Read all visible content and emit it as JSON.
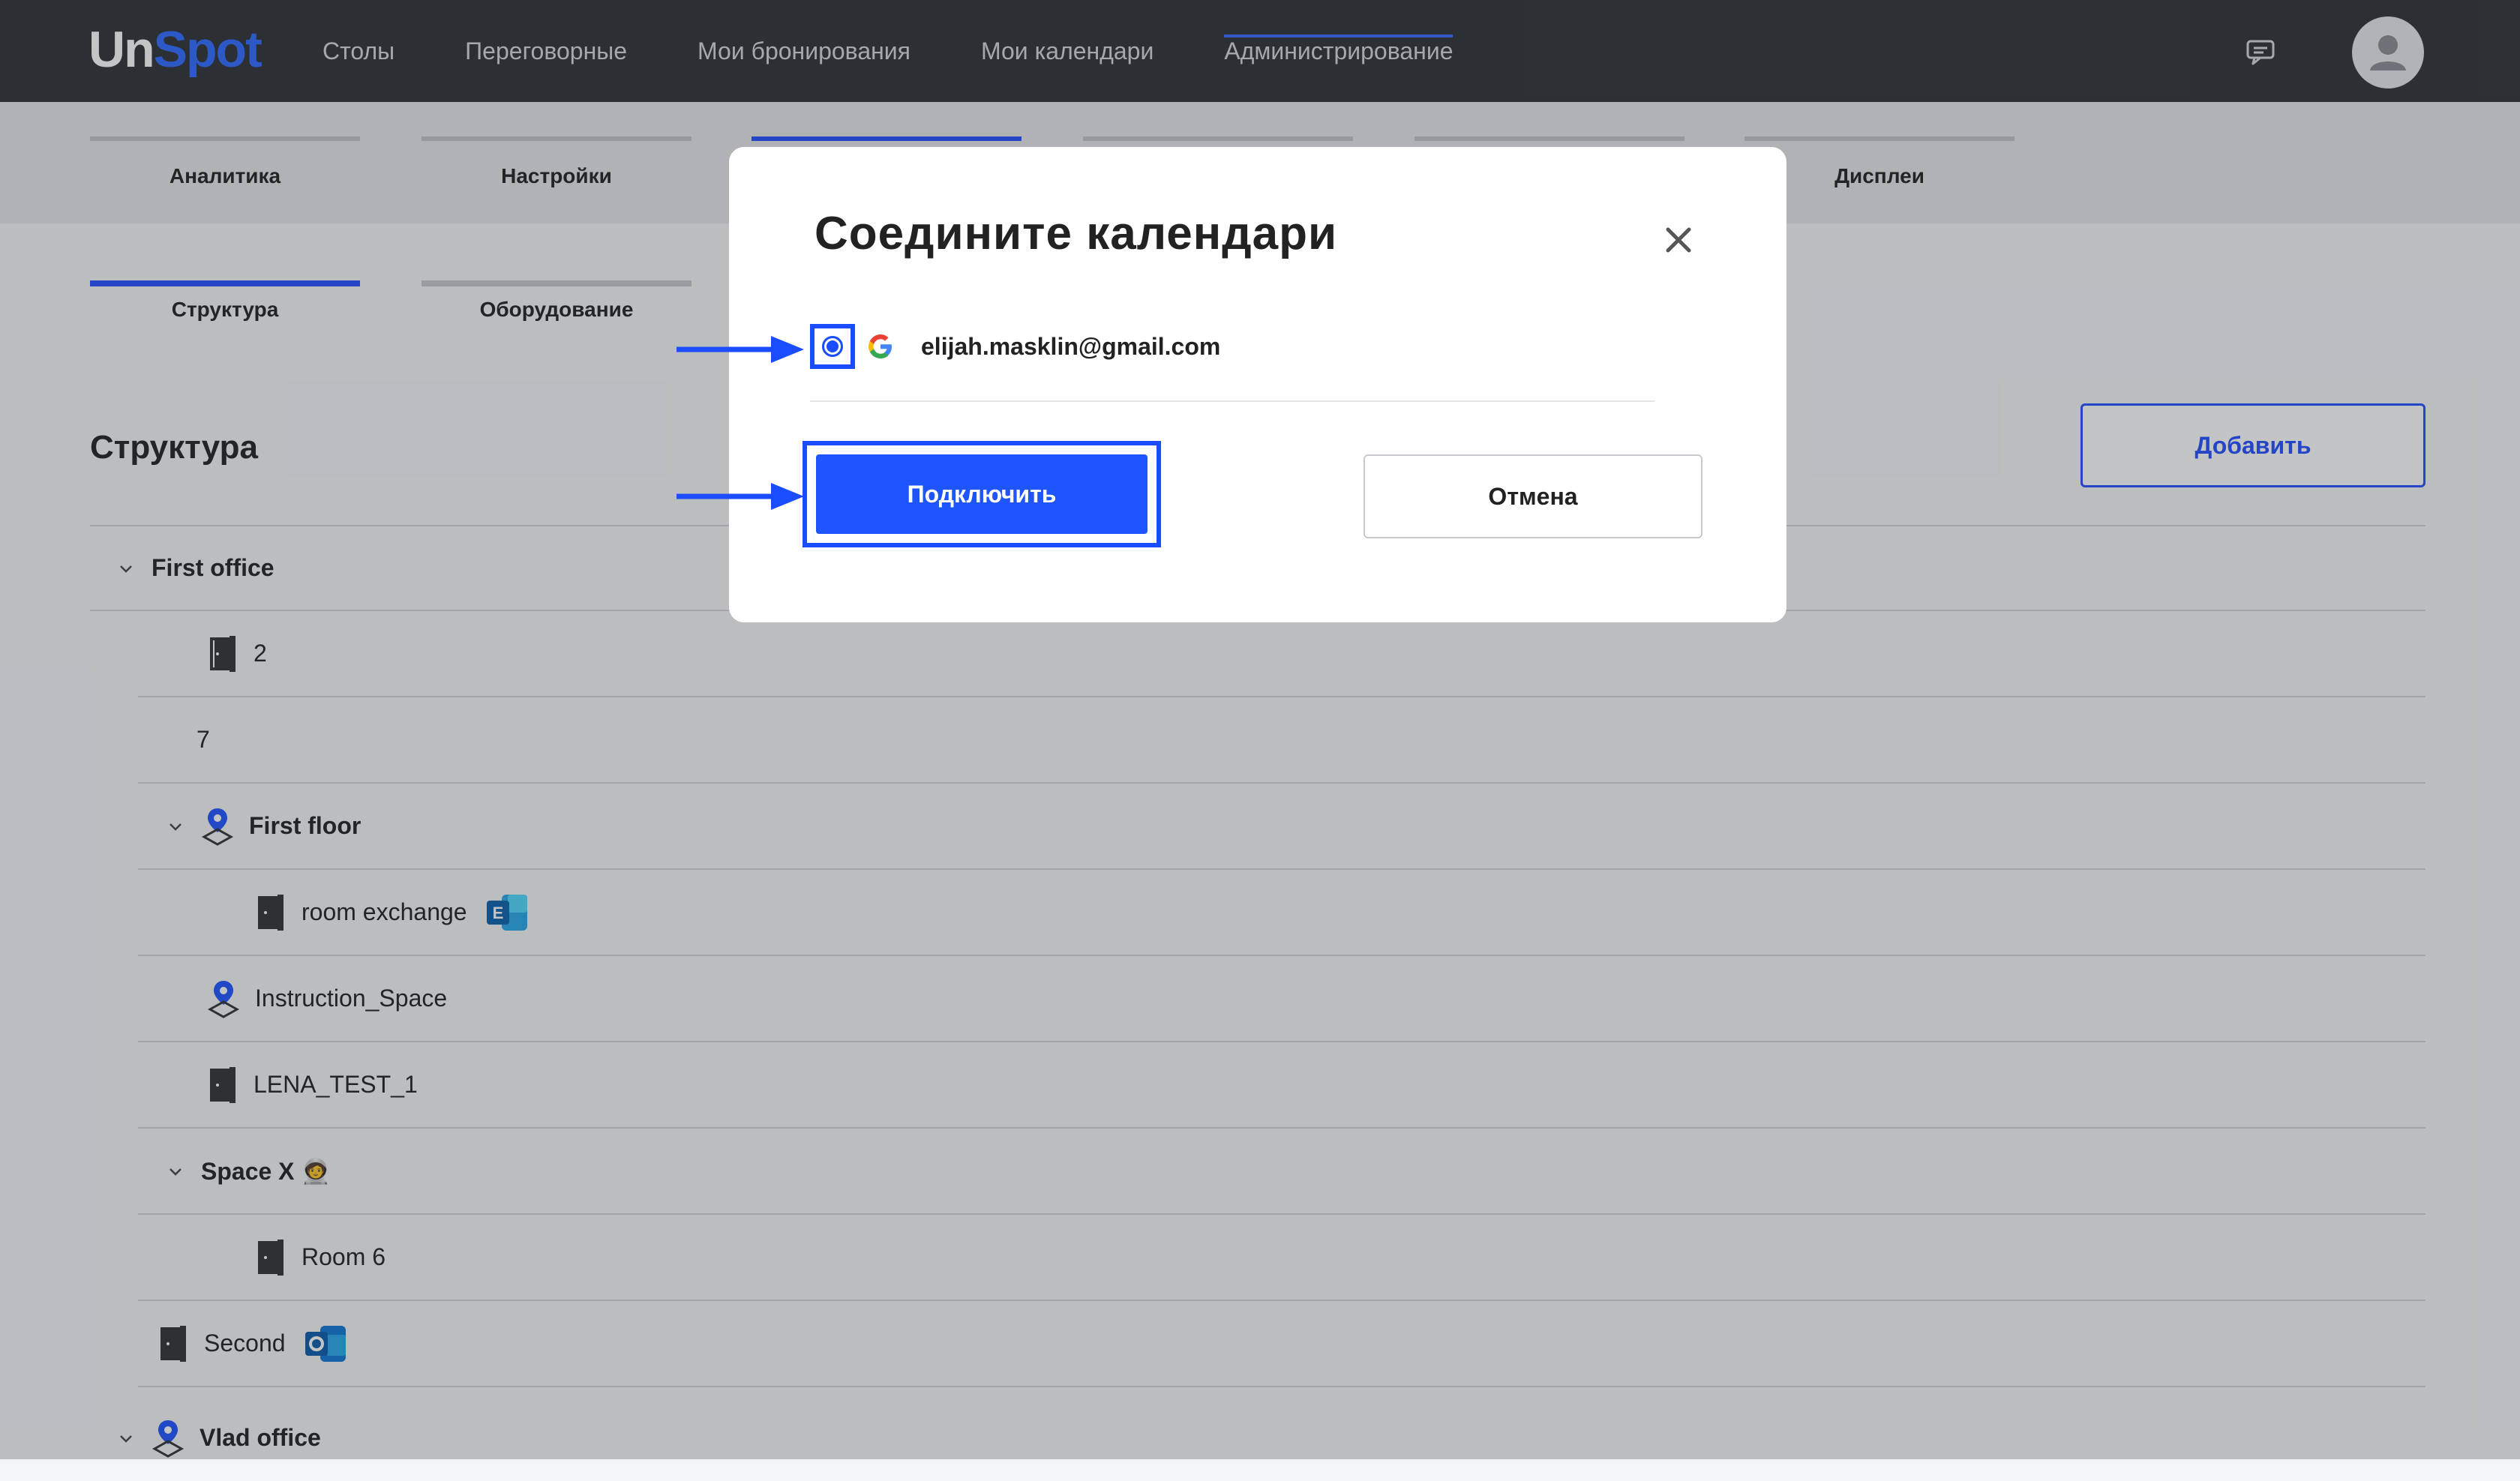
{
  "app": {
    "logo_un": "Un",
    "logo_spot": "Spot"
  },
  "nav": {
    "items": [
      {
        "label": "Столы"
      },
      {
        "label": "Переговорные"
      },
      {
        "label": "Мои бронирования"
      },
      {
        "label": "Мои календари"
      },
      {
        "label": "Администрирование"
      }
    ],
    "active_index": 4
  },
  "tabs_primary": [
    {
      "label": "Аналитика"
    },
    {
      "label": "Настройки"
    },
    {
      "label": ""
    },
    {
      "label": ""
    },
    {
      "label": ""
    },
    {
      "label": "Дисплеи"
    }
  ],
  "tabs_secondary": [
    {
      "label": "Структура"
    },
    {
      "label": "Оборудование"
    }
  ],
  "section": {
    "title": "Структура",
    "add_label": "Добавить"
  },
  "tree": [
    {
      "label": "First office",
      "bold": true,
      "type": "office",
      "expanded": true
    },
    {
      "label": "2",
      "type": "room"
    },
    {
      "label": "7",
      "type": "plain"
    },
    {
      "label": "First floor",
      "bold": true,
      "type": "location",
      "expanded": true
    },
    {
      "label": "room exchange",
      "type": "room",
      "integration": "exchange-icon"
    },
    {
      "label": "Instruction_Space",
      "type": "location"
    },
    {
      "label": "LENA_TEST_1",
      "type": "room"
    },
    {
      "label": "Space X 🧑‍🚀",
      "bold": true,
      "type": "group",
      "expanded": true
    },
    {
      "label": "Room 6",
      "type": "room"
    },
    {
      "label": "Second",
      "type": "room",
      "integration": "outlook-icon"
    },
    {
      "label": "Vlad office",
      "bold": true,
      "type": "location",
      "expanded": true
    }
  ],
  "modal": {
    "title": "Соедините календари",
    "account_email": "elijah.masklin@gmail.com",
    "account_provider": "google-icon",
    "account_selected": true,
    "connect_label": "Подключить",
    "cancel_label": "Отмена"
  },
  "colors": {
    "topbar": "#2f3237",
    "accent": "#1f55ff",
    "logo_spot": "#2f6bff"
  }
}
